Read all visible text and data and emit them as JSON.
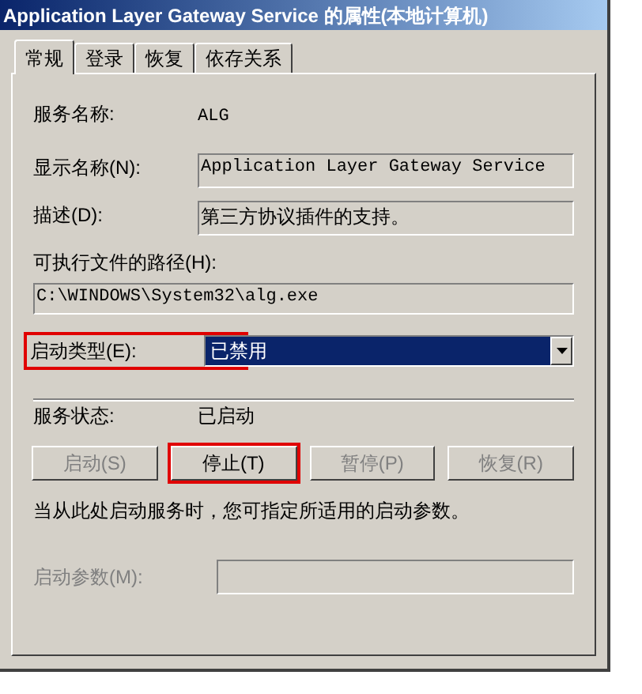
{
  "window": {
    "title": "Application Layer Gateway Service 的属性(本地计算机)"
  },
  "tabs": [
    {
      "label": "常规",
      "selected": true
    },
    {
      "label": "登录",
      "selected": false
    },
    {
      "label": "恢复",
      "selected": false
    },
    {
      "label": "依存关系",
      "selected": false
    }
  ],
  "service_name": {
    "label": "服务名称:",
    "value": "ALG"
  },
  "display_name": {
    "label": "显示名称(N):",
    "value": "Application Layer Gateway Service"
  },
  "description": {
    "label": "描述(D):",
    "value": "第三方协议插件的支持。"
  },
  "executable_path": {
    "label": "可执行文件的路径(H):",
    "value": "C:\\WINDOWS\\System32\\alg.exe"
  },
  "startup_type": {
    "label": "启动类型(E):",
    "value": "已禁用",
    "highlighted": true
  },
  "service_status": {
    "label": "服务状态:",
    "value": "已启动"
  },
  "buttons": [
    {
      "label": "启动(S)",
      "disabled": true,
      "highlighted": false
    },
    {
      "label": "停止(T)",
      "disabled": false,
      "highlighted": true
    },
    {
      "label": "暂停(P)",
      "disabled": true,
      "highlighted": false
    },
    {
      "label": "恢复(R)",
      "disabled": true,
      "highlighted": false
    }
  ],
  "hint": "当从此处启动服务时，您可指定所适用的启动参数。",
  "start_parameters": {
    "label": "启动参数(M):",
    "disabled": true
  }
}
